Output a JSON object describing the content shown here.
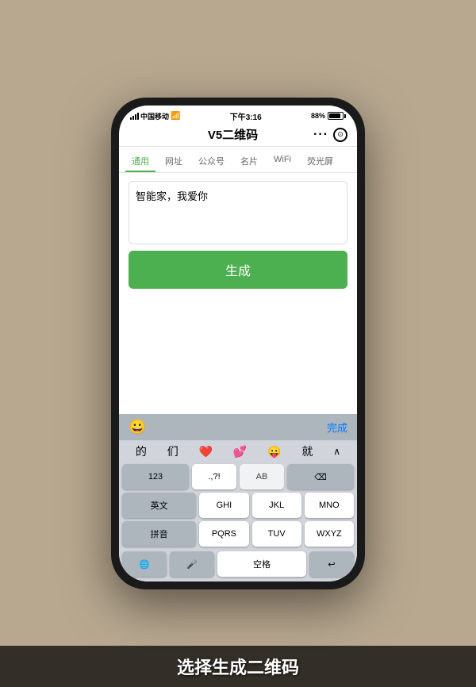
{
  "phone": {
    "status_bar": {
      "carrier": "中国移动",
      "wifi_icon": "wifi",
      "time": "下午3:16",
      "battery_percent": "88%"
    },
    "nav": {
      "title": "V5二维码",
      "dots": "···",
      "scan_icon": "⊙"
    },
    "tabs": [
      {
        "label": "通用",
        "active": true
      },
      {
        "label": "网址",
        "active": false
      },
      {
        "label": "公众号",
        "active": false
      },
      {
        "label": "名片",
        "active": false
      },
      {
        "label": "WiFi",
        "active": false
      },
      {
        "label": "荧光屏",
        "active": false
      }
    ],
    "input_text": "智能家，我爱你",
    "generate_btn": "生成",
    "keyboard": {
      "done_label": "完成",
      "emoji_icon": "😀",
      "predictive": [
        "的",
        "们",
        "❤️",
        "💕",
        "😛",
        "就"
      ],
      "rows": [
        [
          "123",
          ".,?!",
          "AB",
          ""
        ],
        [
          "英文",
          "GHI",
          "JKL",
          ""
        ],
        [
          "拼音",
          "PQRS",
          "TUV",
          ""
        ]
      ],
      "bottom_row": [
        "🌐",
        "🎤",
        "",
        "空",
        "↩"
      ]
    }
  },
  "subtitle": "选择生成二维码"
}
